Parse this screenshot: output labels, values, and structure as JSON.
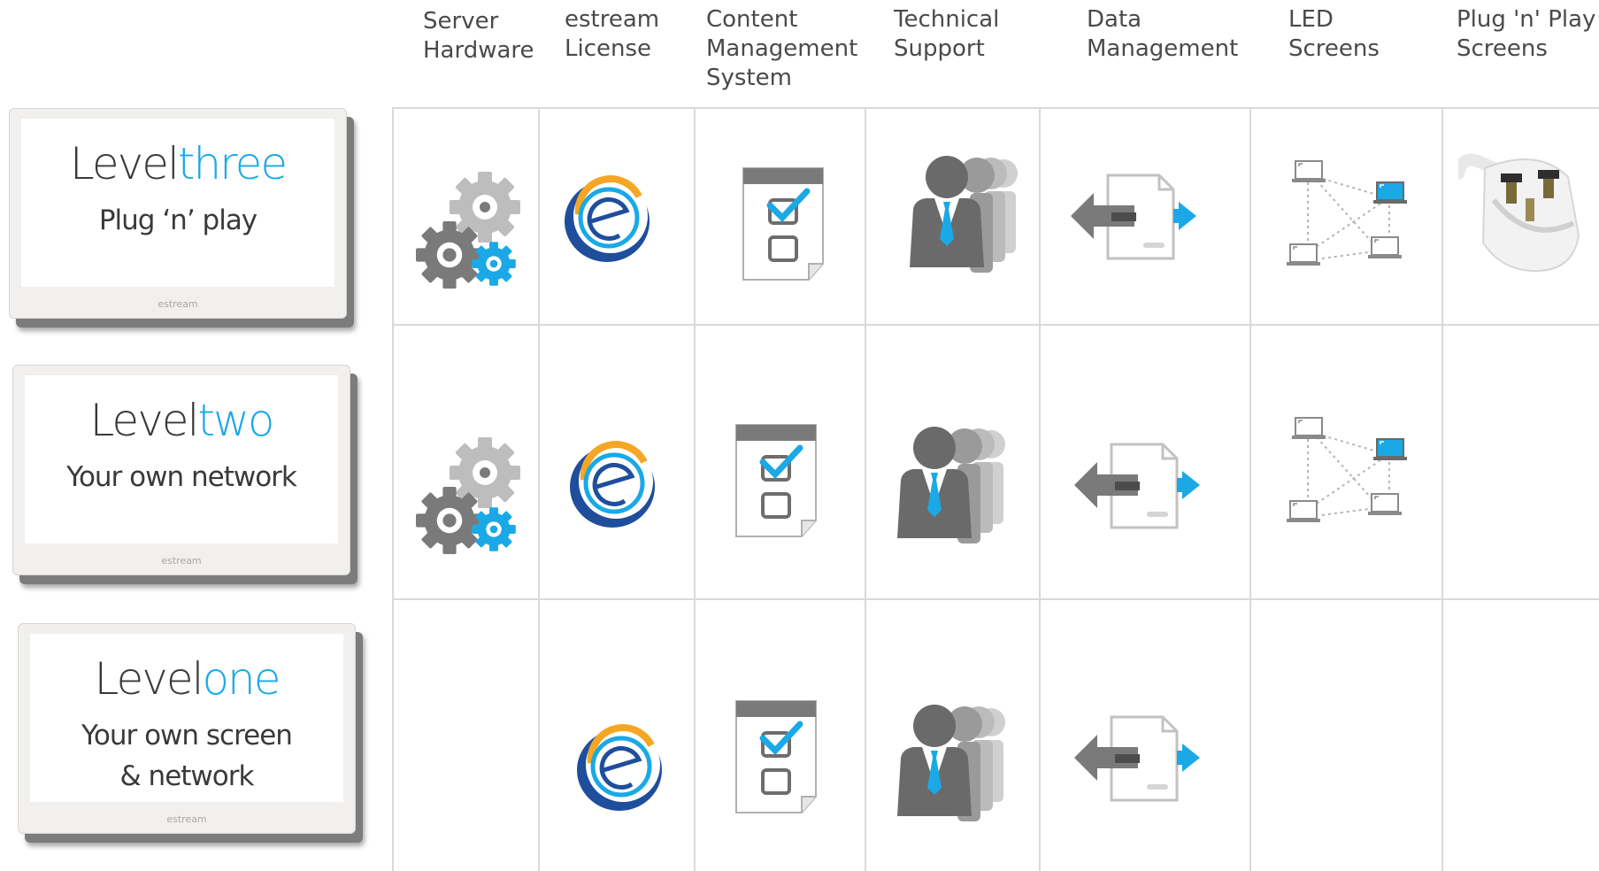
{
  "columns": [
    {
      "label": "Server\nHardware"
    },
    {
      "label": "estream\nLicense"
    },
    {
      "label": "Content\nManagement\nSystem"
    },
    {
      "label": "Technical\nSupport"
    },
    {
      "label": "Data\nManagement"
    },
    {
      "label": "LED\nScreens"
    },
    {
      "label": "Plug 'n' Play\nScreens"
    }
  ],
  "levels": [
    {
      "word": "Level",
      "number": "three",
      "subtitle": "Plug ‘n’ play",
      "logo": "estream"
    },
    {
      "word": "Level",
      "number": "two",
      "subtitle": "Your own network",
      "logo": "estream"
    },
    {
      "word": "Level",
      "number": "one",
      "subtitle": "Your own screen\n& network",
      "logo": "estream"
    }
  ],
  "icons": {
    "server_hardware": "gears-icon",
    "estream_license": "estream-logo-icon",
    "cms": "checklist-document-icon",
    "technical_support": "support-team-icon",
    "data_management": "data-transfer-icon",
    "led_screens": "network-laptops-icon",
    "plug_n_play": "uk-plug-icon"
  },
  "colors": {
    "accent_blue": "#1aa9e6",
    "grey_dark": "#6d6d6d",
    "grey_light": "#b8b8b8",
    "gridline": "#d9d9d9",
    "logo_orange": "#f5a623",
    "logo_navy": "#1f4e9c"
  }
}
